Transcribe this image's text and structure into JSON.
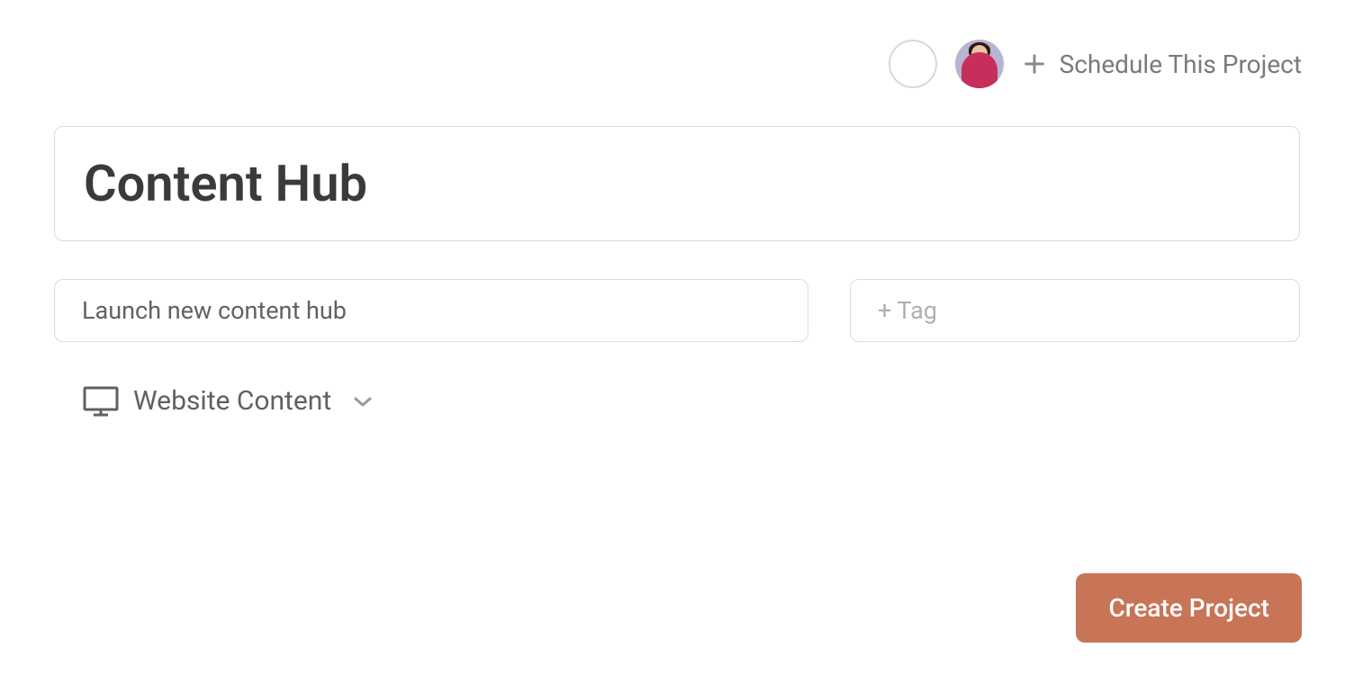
{
  "header": {
    "schedule_label": "Schedule This Project"
  },
  "project": {
    "title": "Content Hub",
    "description": "Launch new content hub",
    "tag_placeholder": "+ Tag",
    "category": "Website Content"
  },
  "actions": {
    "create_label": "Create Project"
  }
}
